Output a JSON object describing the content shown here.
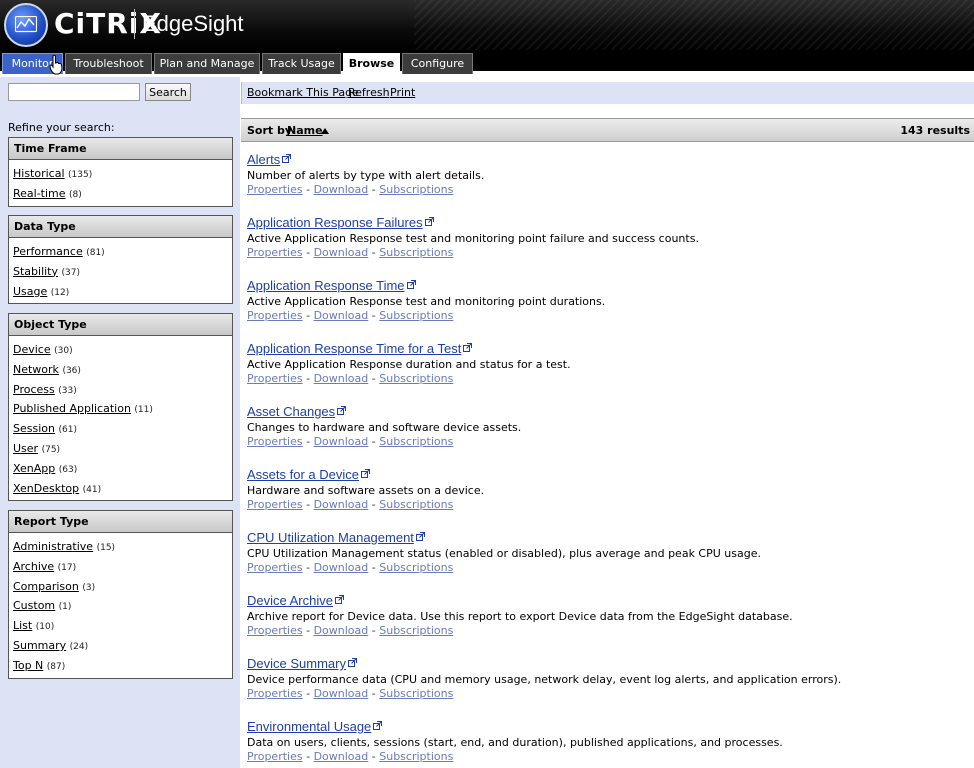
{
  "header": {
    "brand": "CiTRiX",
    "product": "EdgeSight"
  },
  "tabs": [
    {
      "label": "Monitor"
    },
    {
      "label": "Troubleshoot"
    },
    {
      "label": "Plan and Manage"
    },
    {
      "label": "Track Usage"
    },
    {
      "label": "Browse"
    },
    {
      "label": "Configure"
    }
  ],
  "search": {
    "value": "",
    "placeholder": "",
    "button_label": "Search"
  },
  "toolbar": {
    "bookmark": "Bookmark This Page",
    "refresh": "Refresh",
    "print": "Print"
  },
  "sidebar": {
    "refine_label": "Refine your search:",
    "facets": [
      {
        "title": "Time Frame",
        "items": [
          {
            "label": "Historical",
            "count": "(135)"
          },
          {
            "label": "Real-time",
            "count": "(8)"
          }
        ]
      },
      {
        "title": "Data Type",
        "items": [
          {
            "label": "Performance",
            "count": "(81)"
          },
          {
            "label": "Stability",
            "count": "(37)"
          },
          {
            "label": "Usage",
            "count": "(12)"
          }
        ]
      },
      {
        "title": "Object Type",
        "items": [
          {
            "label": "Device",
            "count": "(30)"
          },
          {
            "label": "Network",
            "count": "(36)"
          },
          {
            "label": "Process",
            "count": "(33)"
          },
          {
            "label": "Published Application",
            "count": "(11)"
          },
          {
            "label": "Session",
            "count": "(61)"
          },
          {
            "label": "User",
            "count": "(75)"
          },
          {
            "label": "XenApp",
            "count": "(63)"
          },
          {
            "label": "XenDesktop",
            "count": "(41)"
          }
        ]
      },
      {
        "title": "Report Type",
        "items": [
          {
            "label": "Administrative",
            "count": "(15)"
          },
          {
            "label": "Archive",
            "count": "(17)"
          },
          {
            "label": "Comparison",
            "count": "(3)"
          },
          {
            "label": "Custom",
            "count": "(1)"
          },
          {
            "label": "List",
            "count": "(10)"
          },
          {
            "label": "Summary",
            "count": "(24)"
          },
          {
            "label": "Top N",
            "count": "(87)"
          }
        ]
      }
    ]
  },
  "sort": {
    "label": "Sort by:",
    "field": "Name",
    "results": "143 results"
  },
  "links": {
    "properties": "Properties",
    "download": "Download",
    "subscriptions": "Subscriptions",
    "separator": "-"
  },
  "results": [
    {
      "title": "Alerts",
      "desc": "Number of alerts by type with alert details."
    },
    {
      "title": "Application Response Failures",
      "desc": "Active Application Response test and monitoring point failure and success counts."
    },
    {
      "title": "Application Response Time",
      "desc": "Active Application Response test and monitoring point durations."
    },
    {
      "title": "Application Response Time for a Test",
      "desc": "Active Application Response duration and status for a test."
    },
    {
      "title": "Asset Changes",
      "desc": "Changes to hardware and software device assets."
    },
    {
      "title": "Assets for a Device",
      "desc": "Hardware and software assets on a device."
    },
    {
      "title": "CPU Utilization Management",
      "desc": "CPU Utilization Management status (enabled or disabled), plus average and peak CPU usage."
    },
    {
      "title": "Device Archive",
      "desc": "Archive report for Device data. Use this report to export Device data from the EdgeSight database."
    },
    {
      "title": "Device Summary",
      "desc": "Device performance data (CPU and memory usage, network delay, event log alerts, and application errors)."
    },
    {
      "title": "Environmental Usage",
      "desc": "Data on users, clients, sessions (start, end, and duration), published applications, and processes."
    }
  ]
}
